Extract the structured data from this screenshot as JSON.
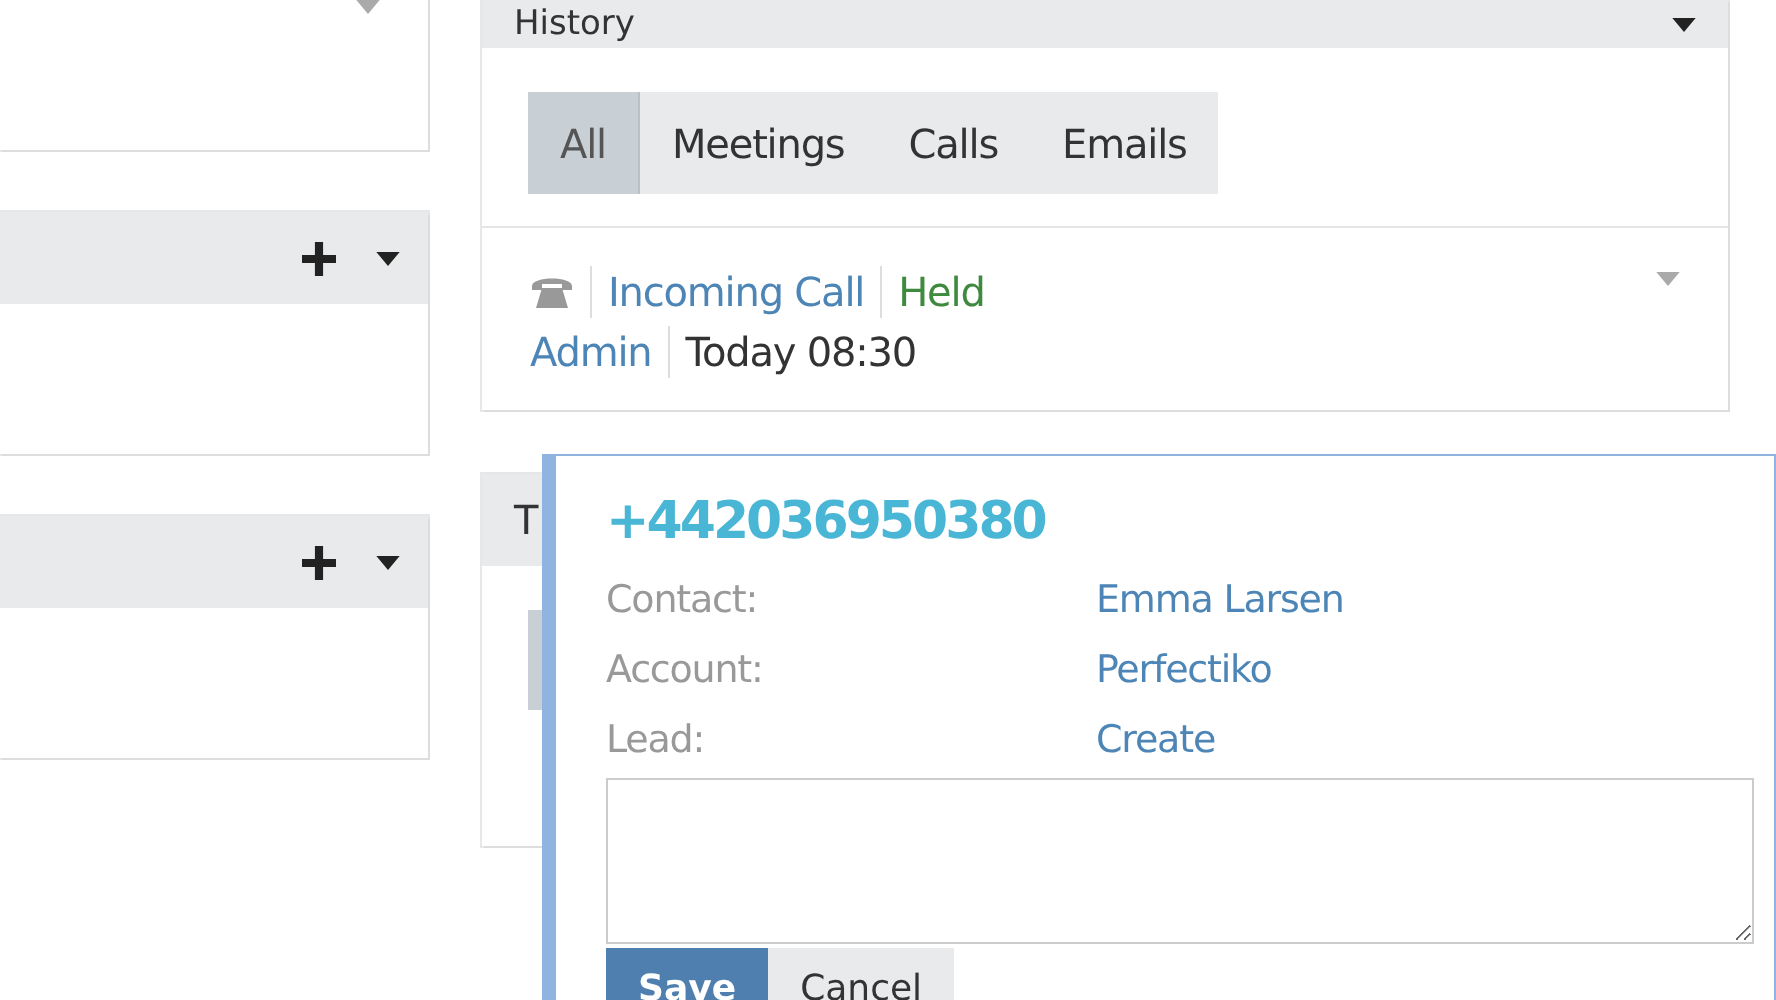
{
  "left_panels": [
    {
      "header": false
    },
    {
      "header": true
    },
    {
      "header": true
    }
  ],
  "history": {
    "title": "History",
    "tabs": [
      {
        "label": "All",
        "selected": true
      },
      {
        "label": "Meetings",
        "selected": false
      },
      {
        "label": "Calls",
        "selected": false
      },
      {
        "label": "Emails",
        "selected": false
      }
    ],
    "items": [
      {
        "type": "Incoming Call",
        "status": "Held",
        "user": "Admin",
        "time": "Today 08:30"
      }
    ]
  },
  "second_panel": {
    "title": "T"
  },
  "popup": {
    "phone": "+442036950380",
    "fields": [
      {
        "label": "Contact:",
        "value": "Emma Larsen"
      },
      {
        "label": "Account:",
        "value": "Perfectiko"
      },
      {
        "label": "Lead:",
        "value": "Create"
      }
    ],
    "buttons": [
      {
        "label": "Save",
        "kind": "primary"
      },
      {
        "label": "Cancel",
        "kind": "default"
      }
    ]
  }
}
